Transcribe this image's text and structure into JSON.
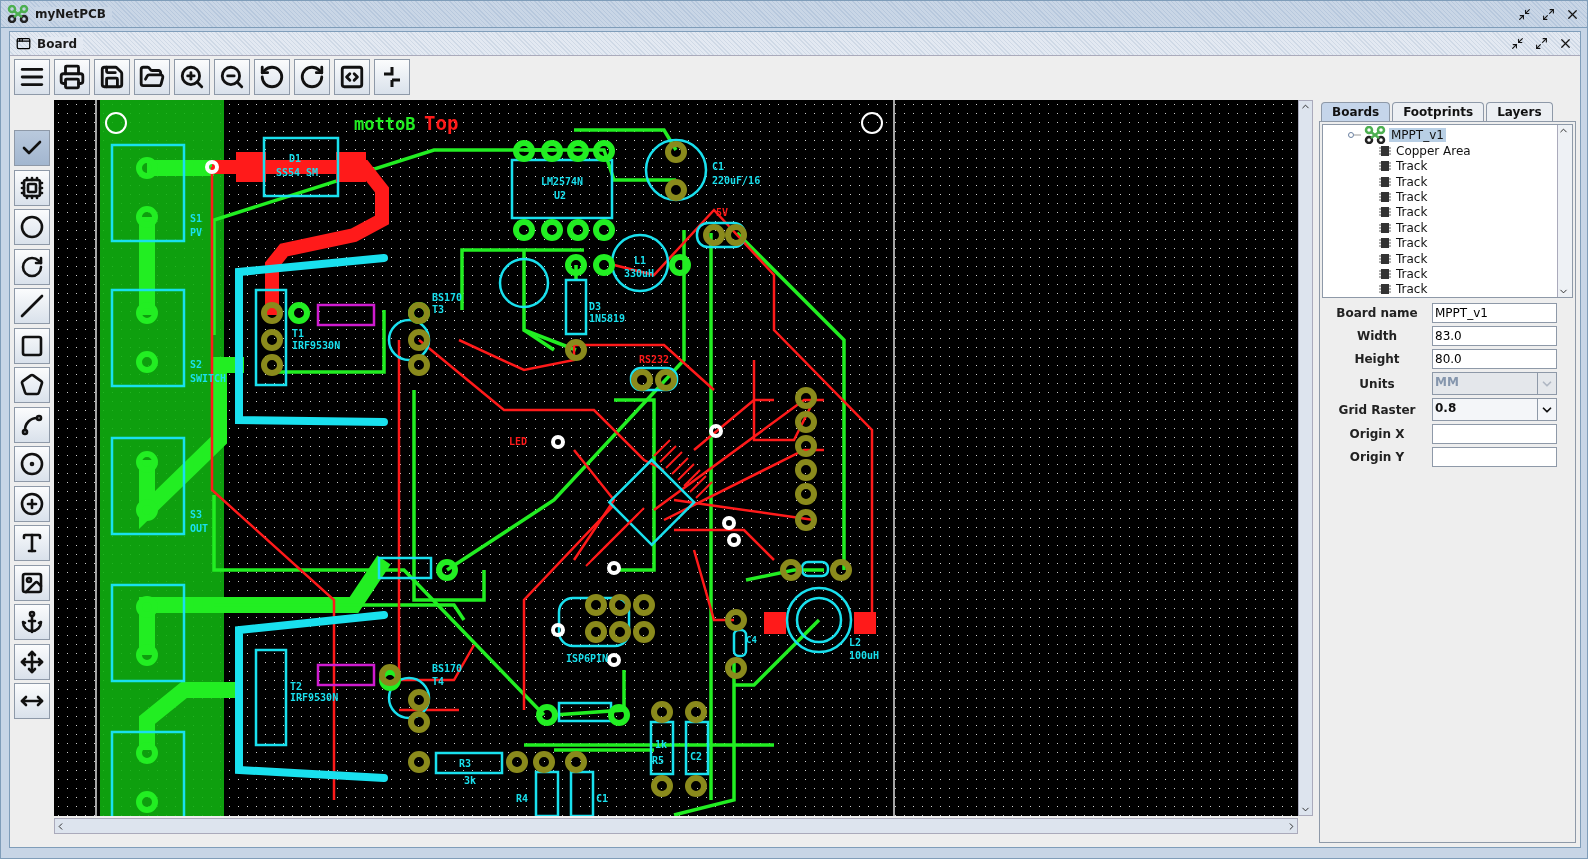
{
  "window": {
    "title": "myNetPCB"
  },
  "frame": {
    "title": "Board"
  },
  "toolbar": {
    "buttons": [
      {
        "kind": "menu"
      },
      {
        "kind": "print"
      },
      {
        "kind": "save"
      },
      {
        "kind": "open"
      },
      {
        "kind": "zoom-in"
      },
      {
        "kind": "zoom-out"
      },
      {
        "kind": "undo"
      },
      {
        "kind": "redo"
      },
      {
        "kind": "code"
      },
      {
        "kind": "snap"
      }
    ]
  },
  "tools": [
    {
      "kind": "select",
      "selected": true
    },
    {
      "kind": "chip",
      "selected": false
    },
    {
      "kind": "circle",
      "selected": false
    },
    {
      "kind": "arc",
      "selected": false
    },
    {
      "kind": "line",
      "selected": false
    },
    {
      "kind": "rect",
      "selected": false
    },
    {
      "kind": "shape",
      "selected": false
    },
    {
      "kind": "track",
      "selected": false
    },
    {
      "kind": "pad",
      "selected": false
    },
    {
      "kind": "via",
      "selected": false
    },
    {
      "kind": "text",
      "selected": false
    },
    {
      "kind": "image",
      "selected": false
    },
    {
      "kind": "anchor",
      "selected": false
    },
    {
      "kind": "origin",
      "selected": false
    },
    {
      "kind": "measure",
      "selected": false
    }
  ],
  "pcb": {
    "labels": [
      {
        "text": "mottoB",
        "color": "#22ee22"
      },
      {
        "text": "Top",
        "color": "#ff1a1a"
      },
      {
        "text": "D1",
        "color": "#19e0ee"
      },
      {
        "text": "SS54 SM",
        "color": "#19e0ee"
      },
      {
        "text": "LM2574N",
        "color": "#19e0ee"
      },
      {
        "text": "U2",
        "color": "#19e0ee"
      },
      {
        "text": "C1",
        "color": "#19e0ee"
      },
      {
        "text": "220uF/16",
        "color": "#19e0ee"
      },
      {
        "text": "L1",
        "color": "#19e0ee"
      },
      {
        "text": "330uH",
        "color": "#19e0ee"
      },
      {
        "text": "D3",
        "color": "#19e0ee"
      },
      {
        "text": "1N5819",
        "color": "#19e0ee"
      },
      {
        "text": "T1",
        "color": "#19e0ee"
      },
      {
        "text": "IRF9530N",
        "color": "#19e0ee"
      },
      {
        "text": "BS170",
        "color": "#19e0ee"
      },
      {
        "text": "T3",
        "color": "#19e0ee"
      },
      {
        "text": "RS232",
        "color": "#ff1a1a"
      },
      {
        "text": "T2",
        "color": "#19e0ee"
      },
      {
        "text": "IRF9530N",
        "color": "#19e0ee"
      },
      {
        "text": "BS170",
        "color": "#19e0ee"
      },
      {
        "text": "T4",
        "color": "#19e0ee"
      },
      {
        "text": "ISP6PIN",
        "color": "#19e0ee"
      },
      {
        "text": "L2",
        "color": "#19e0ee"
      },
      {
        "text": "100uH",
        "color": "#19e0ee"
      },
      {
        "text": "C4",
        "color": "#19e0ee"
      },
      {
        "text": "R3",
        "color": "#19e0ee"
      },
      {
        "text": "3k",
        "color": "#19e0ee"
      },
      {
        "text": "1k",
        "color": "#19e0ee"
      },
      {
        "text": "R5",
        "color": "#19e0ee"
      },
      {
        "text": "C2",
        "color": "#19e0ee"
      },
      {
        "text": "R4",
        "color": "#19e0ee"
      },
      {
        "text": "C1",
        "color": "#19e0ee"
      },
      {
        "text": "5V",
        "color": "#ff1a1a"
      },
      {
        "text": "LED",
        "color": "#ff1a1a"
      },
      {
        "text": "S1",
        "color": "#19e0ee"
      },
      {
        "text": "PV",
        "color": "#19e0ee"
      },
      {
        "text": "S2",
        "color": "#19e0ee"
      },
      {
        "text": "SWITCH",
        "color": "#19e0ee"
      },
      {
        "text": "S3",
        "color": "#19e0ee"
      },
      {
        "text": "OUT",
        "color": "#19e0ee"
      }
    ]
  },
  "tabs": [
    {
      "label": "Boards",
      "selected": true
    },
    {
      "label": "Footprints",
      "selected": false
    },
    {
      "label": "Layers",
      "selected": false
    }
  ],
  "tree": {
    "items": [
      {
        "label": "MPPT_v1",
        "kind": "board",
        "selected": true,
        "expanded": true,
        "children": [
          {
            "label": "Copper Area",
            "kind": "shape",
            "selected": false
          },
          {
            "label": "Track",
            "kind": "shape",
            "selected": false
          },
          {
            "label": "Track",
            "kind": "shape",
            "selected": false
          },
          {
            "label": "Track",
            "kind": "shape",
            "selected": false
          },
          {
            "label": "Track",
            "kind": "shape",
            "selected": false
          },
          {
            "label": "Track",
            "kind": "shape",
            "selected": false
          },
          {
            "label": "Track",
            "kind": "shape",
            "selected": false
          },
          {
            "label": "Track",
            "kind": "shape",
            "selected": false
          },
          {
            "label": "Track",
            "kind": "shape",
            "selected": false
          },
          {
            "label": "Track",
            "kind": "shape",
            "selected": false
          }
        ]
      }
    ]
  },
  "properties": [
    {
      "label": "Board name",
      "kind": "text",
      "value": "MPPT_v1"
    },
    {
      "label": "Width",
      "kind": "text",
      "value": "83.0"
    },
    {
      "label": "Height",
      "kind": "text",
      "value": "80.0"
    },
    {
      "label": "Units",
      "kind": "select",
      "value": "MM",
      "disabled": true
    },
    {
      "label": "Grid Raster",
      "kind": "select",
      "value": "0.8",
      "disabled": false
    },
    {
      "label": "Origin X",
      "kind": "text"
    },
    {
      "label": "Origin Y",
      "kind": "text"
    }
  ]
}
